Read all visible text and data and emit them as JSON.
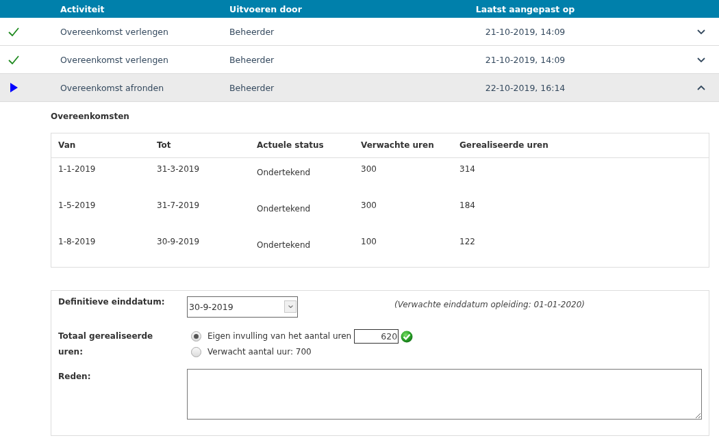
{
  "activities": {
    "columns": [
      "Activiteit",
      "Uitvoeren door",
      "Laatst aangepast op"
    ],
    "rows": [
      {
        "kind": "done",
        "activity": "Overeenkomst verlengen",
        "performer": "Beheerder",
        "modified": "21-10-2019, 14:09",
        "expanded": false
      },
      {
        "kind": "done",
        "activity": "Overeenkomst verlengen",
        "performer": "Beheerder",
        "modified": "21-10-2019, 14:09",
        "expanded": false
      },
      {
        "kind": "current",
        "activity": "Overeenkomst afronden",
        "performer": "Beheerder",
        "modified": "22-10-2019, 16:14",
        "expanded": true
      }
    ]
  },
  "details": {
    "title": "Overeenkomsten",
    "table": {
      "columns": [
        "Van",
        "Tot",
        "Actuele status",
        "Verwachte uren",
        "Gerealiseerde uren"
      ],
      "rows": [
        {
          "from": "1-1-2019",
          "to": "31-3-2019",
          "status": "Ondertekend",
          "expected": "300",
          "realised": "314"
        },
        {
          "from": "1-5-2019",
          "to": "31-7-2019",
          "status": "Ondertekend",
          "expected": "300",
          "realised": "184"
        },
        {
          "from": "1-8-2019",
          "to": "30-9-2019",
          "status": "Ondertekend",
          "expected": "100",
          "realised": "122"
        }
      ]
    },
    "form": {
      "end_date": {
        "label": "Definitieve einddatum:",
        "value": "30-9-2019",
        "hint": "(Verwachte einddatum opleiding: 01-01-2020)"
      },
      "hours": {
        "label": "Totaal gerealiseerde uren:",
        "options": [
          {
            "kind": "input",
            "label": "Eigen invulling van het aantal uren",
            "selected": true,
            "value": "620",
            "valid": true
          },
          {
            "kind": "plain",
            "label": "Verwacht aantal uur: 700",
            "selected": false
          }
        ]
      },
      "reason": {
        "label": "Reden:"
      }
    }
  }
}
